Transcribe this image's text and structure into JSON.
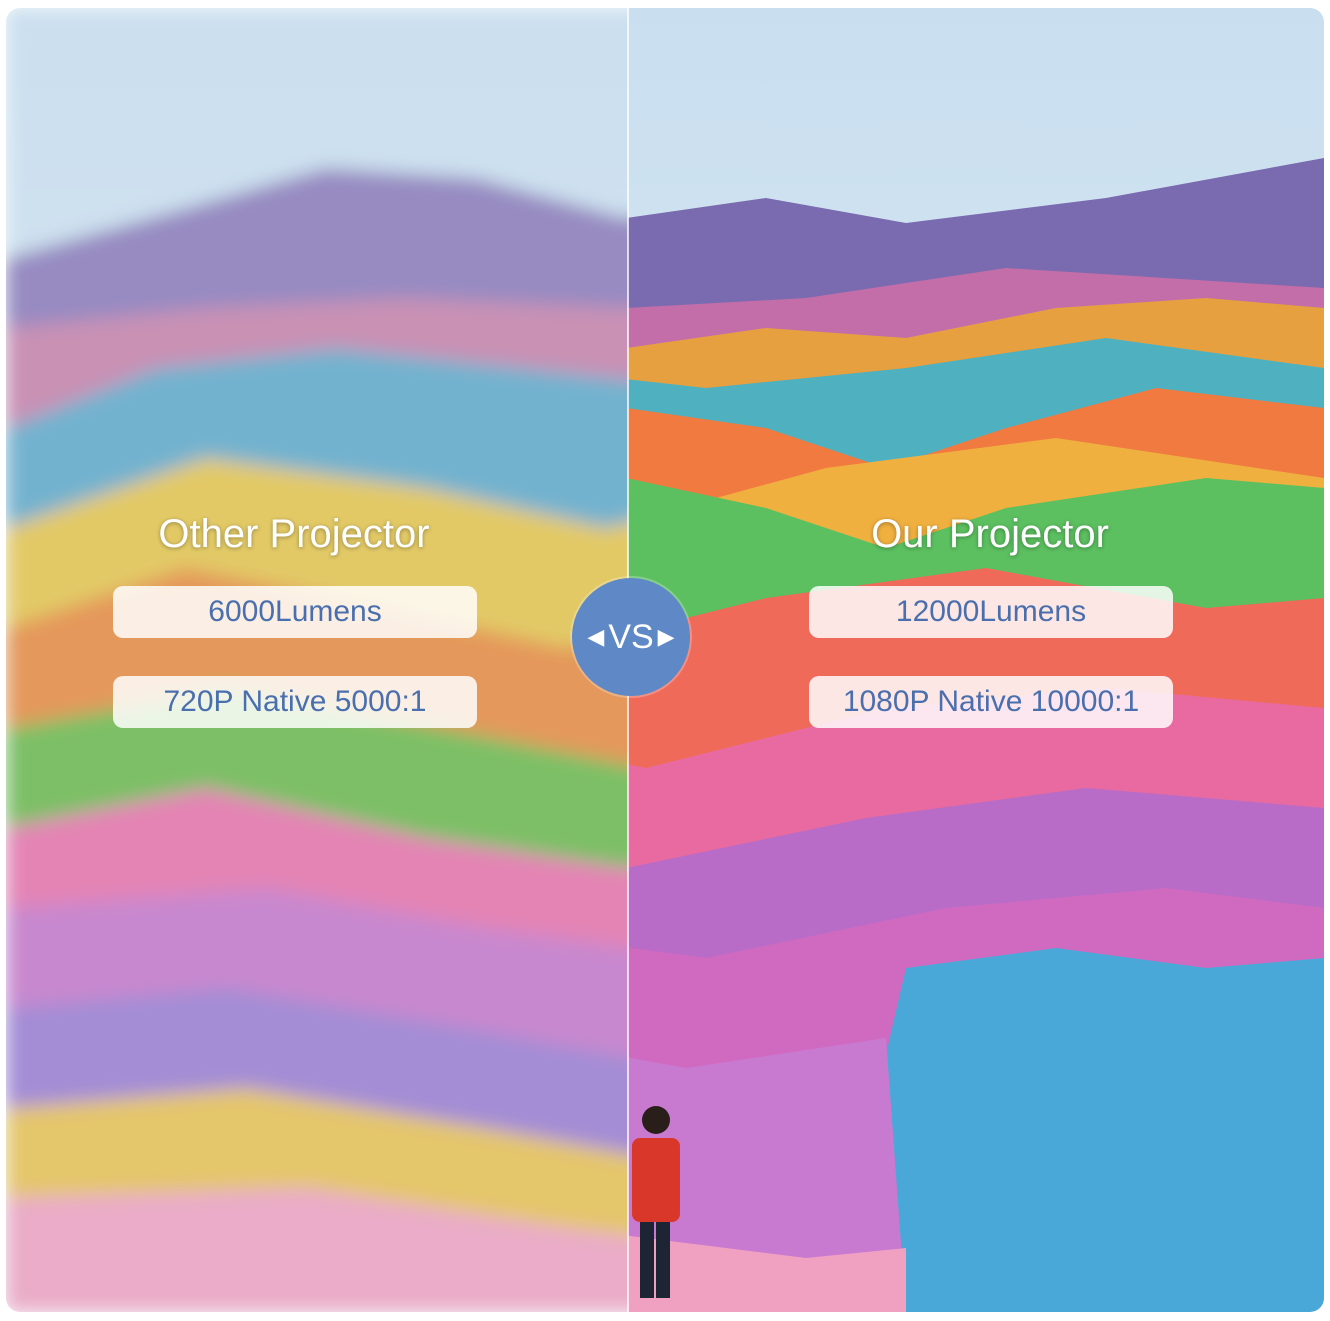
{
  "comparison": {
    "left": {
      "title": "Other Projector",
      "specs": [
        "6000Lumens",
        "720P Native 5000:1"
      ]
    },
    "right": {
      "title": "Our Projector",
      "specs": [
        "12000Lumens",
        "1080P Native 10000:1"
      ]
    },
    "badge": {
      "label": "VS",
      "left_arrow": "◀",
      "right_arrow": "▶"
    }
  },
  "colors": {
    "badge": "#5f89c6",
    "pill_text": "#4a6fae",
    "heading_text": "#ffffff"
  }
}
